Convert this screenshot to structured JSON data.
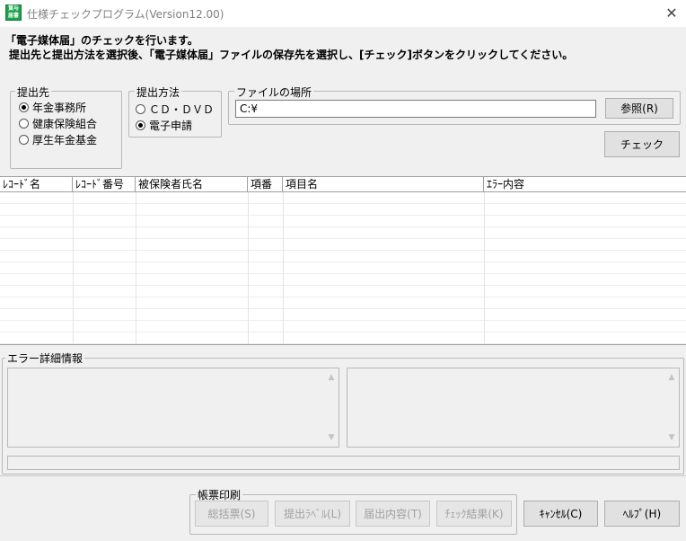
{
  "window": {
    "title": "仕様チェックプログラム(Version12.00)",
    "icon_label": "賞与届書",
    "close_glyph": "✕"
  },
  "instructions": {
    "line1": "「電子媒体届」のチェックを行います。",
    "line2": "提出先と提出方法を選択後、「電子媒体届」ファイルの保存先を選択し、[チェック]ボタンをクリックしてください。"
  },
  "destination": {
    "legend": "提出先",
    "options": [
      {
        "label": "年金事務所",
        "checked": true
      },
      {
        "label": "健康保険組合",
        "checked": false
      },
      {
        "label": "厚生年金基金",
        "checked": false
      }
    ]
  },
  "method": {
    "legend": "提出方法",
    "options": [
      {
        "label": "ＣＤ・ＤＶＤ",
        "checked": false
      },
      {
        "label": "電子申請",
        "checked": true
      }
    ]
  },
  "file_location": {
    "legend": "ファイルの場所",
    "path": "C:¥",
    "browse_label": "参照(R)"
  },
  "check_button": "チェック",
  "table": {
    "columns": [
      "ﾚｺｰﾄﾞ名",
      "ﾚｺｰﾄﾞ番号",
      "被保険者氏名",
      "項番",
      "項目名",
      "ｴﾗｰ内容"
    ]
  },
  "error_details": {
    "legend": "エラー詳細情報"
  },
  "print": {
    "legend": "帳票印刷",
    "buttons": [
      "総括票(S)",
      "提出ﾗﾍﾞﾙ(L)",
      "届出内容(T)",
      "ﾁｪｯｸ結果(K)"
    ]
  },
  "cancel_button": "ｷｬﾝｾﾙ(C)",
  "help_button": "ﾍﾙﾌﾟ(H)"
}
